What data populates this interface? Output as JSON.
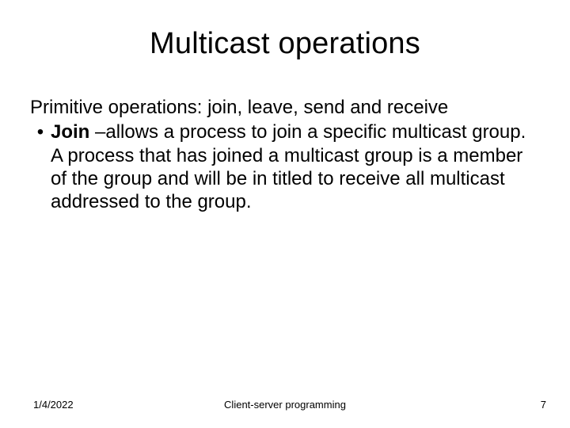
{
  "title": "Multicast operations",
  "intro": "Primitive operations: join, leave, send and receive",
  "bullet": {
    "marker": "•",
    "term": "Join",
    "rest": " –allows a process to join a specific multicast group.  A process that has joined a multicast group is a member of the group and will be in titled to receive all multicast addressed to the group."
  },
  "footer": {
    "date": "1/4/2022",
    "center": "Client-server programming",
    "page": "7"
  }
}
